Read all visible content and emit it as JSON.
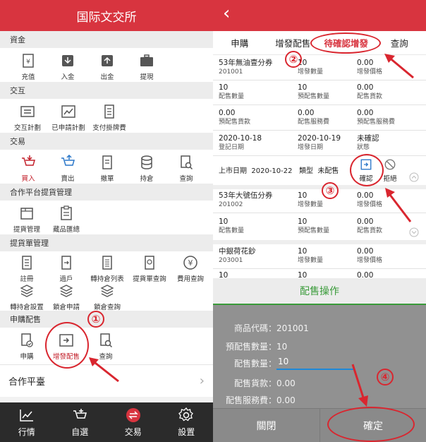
{
  "left": {
    "title": "国际文交所",
    "sections": [
      {
        "title": "資金",
        "items": [
          "充值",
          "入金",
          "出金",
          "提現"
        ]
      },
      {
        "title": "交互",
        "items": [
          "交互計劃",
          "已申請計劃",
          "支付掛牌費"
        ]
      },
      {
        "title": "交易",
        "items": [
          "買入",
          "賣出",
          "撤單",
          "持倉",
          "查詢"
        ]
      },
      {
        "title": "合作平台提貨管理",
        "items": [
          "提貨管理",
          "藏品匯總"
        ]
      },
      {
        "title": "提貨單管理",
        "items": [
          "註冊",
          "過戶",
          "轉持倉列表",
          "提貨單查詢",
          "費用查詢",
          "轉持倉設置",
          "鎖倉申請",
          "鎖倉查詢"
        ]
      },
      {
        "title": "申購配售",
        "items": [
          "申購",
          "增發配售",
          "查詢"
        ]
      }
    ],
    "cooperate": "合作平臺",
    "cooperate_arrow": "›",
    "tabs": [
      "行情",
      "自選",
      "交易",
      "設置"
    ]
  },
  "right": {
    "back": "‹",
    "tabs": [
      "申購",
      "增發配售",
      "待確認增發",
      "查詢"
    ],
    "rows": [
      {
        "c1": [
          "53年無油壹分券",
          "201001"
        ],
        "c2": [
          "10",
          "增發數量"
        ],
        "c3": [
          "0.00",
          "增發價格"
        ]
      },
      {
        "c1": [
          "10",
          "配售數量"
        ],
        "c2": [
          "10",
          "預配售數量"
        ],
        "c3": [
          "0.00",
          "配售貨款"
        ]
      },
      {
        "c1": [
          "0.00",
          "預配售貨款"
        ],
        "c2": [
          "0.00",
          "配售服務費"
        ],
        "c3": [
          "0.00",
          "預配售服務費"
        ]
      },
      {
        "c1": [
          "2020-10-18",
          "登記日期"
        ],
        "c2": [
          "2020-10-19",
          "增發日期"
        ],
        "c3": [
          "未確認",
          "狀態"
        ]
      }
    ],
    "list_date_label": "上市日期",
    "list_date": "2020-10-22",
    "type_label": "類型",
    "type_value": "未配售",
    "confirm": "確認",
    "reject": "拒絕",
    "rows2": [
      {
        "c1": [
          "53年大號伍分券",
          "201002"
        ],
        "c2": [
          "10",
          "增發數量"
        ],
        "c3": [
          "0.00",
          "增發價格"
        ]
      },
      {
        "c1": [
          "10",
          "配售數量"
        ],
        "c2": [
          "10",
          "預配售數量"
        ],
        "c3": [
          "0.00",
          "配售貨款"
        ]
      }
    ],
    "rows3": [
      {
        "c1": [
          "中銀荷花鈔",
          "203001"
        ],
        "c2": [
          "10",
          "增發數量"
        ],
        "c3": [
          "0.00",
          "增發價格"
        ]
      },
      {
        "c1": [
          "10",
          ""
        ],
        "c2": [
          "10",
          ""
        ],
        "c3": [
          "0.00",
          ""
        ]
      }
    ],
    "dialog": {
      "title": "配售操作",
      "fields": [
        {
          "k": "商品代碼：",
          "v": "201001"
        },
        {
          "k": "預配售數量：",
          "v": "10"
        },
        {
          "k": "配售數量：",
          "v": "10"
        },
        {
          "k": "配售貨款：",
          "v": "0.00"
        },
        {
          "k": "配售服務費：",
          "v": "0.00"
        }
      ],
      "close": "關閉",
      "ok": "確定"
    }
  },
  "annotations": [
    "①",
    "②",
    "③",
    "④"
  ],
  "colors": {
    "brand": "#d8343f",
    "annotation": "#d9262f",
    "dialog_green": "#3a9b3a"
  }
}
